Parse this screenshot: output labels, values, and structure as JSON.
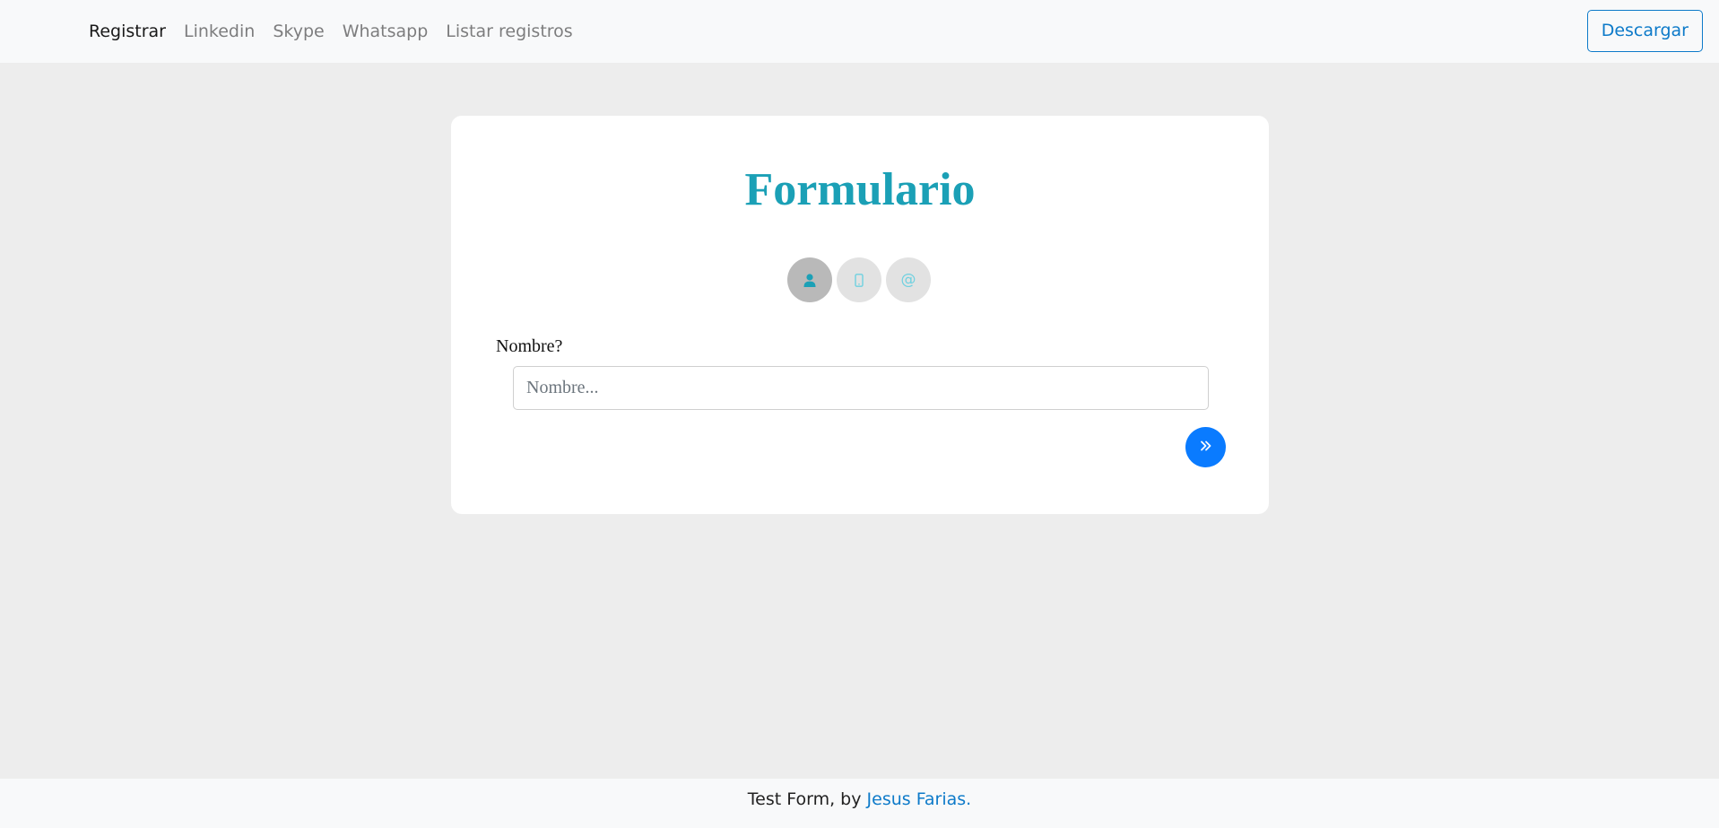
{
  "navbar": {
    "links": [
      {
        "label": "Registrar",
        "active": true
      },
      {
        "label": "Linkedin",
        "active": false
      },
      {
        "label": "Skype",
        "active": false
      },
      {
        "label": "Whatsapp",
        "active": false
      },
      {
        "label": "Listar registros",
        "active": false
      }
    ],
    "download_label": "Descargar"
  },
  "form": {
    "title": "Formulario",
    "steps": [
      {
        "icon": "user-icon",
        "active": true
      },
      {
        "icon": "mobile-phone-icon",
        "active": false
      },
      {
        "icon": "at-sign-icon",
        "symbol": "@",
        "active": false
      }
    ],
    "field_label": "Nombre?",
    "field_placeholder": "Nombre...",
    "field_value": "",
    "next_icon": "double-chevron-right-icon"
  },
  "footer": {
    "prefix": "Test Form, by ",
    "author_link": "Jesus Farias."
  },
  "colors": {
    "accent": "#1ba0b6",
    "primary": "#0a7bff",
    "link": "#0d7ac9",
    "background": "#ededed"
  }
}
